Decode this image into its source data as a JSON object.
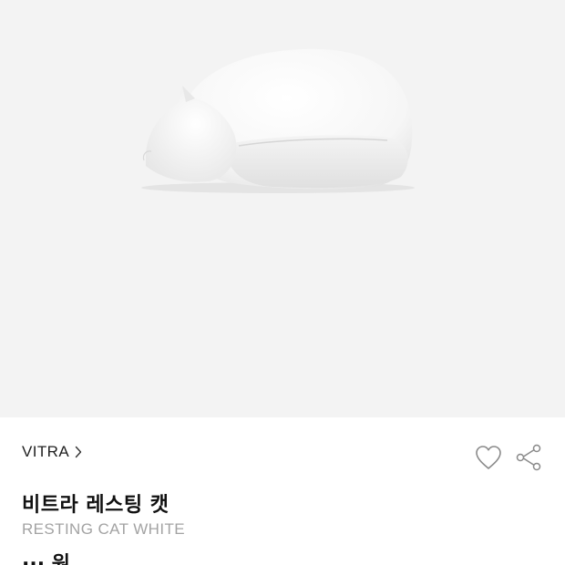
{
  "product": {
    "image_alt": "Vitra Resting Cat white figurine",
    "brand": "VITRA",
    "title_ko": "비트라 레스팅 캣",
    "title_en": "RESTING CAT WHITE",
    "price_partial": "··· 원"
  },
  "icons": {
    "brand_chevron": "chevron-right-icon",
    "wishlist": "heart-icon",
    "share": "share-icon"
  },
  "colors": {
    "hero_background": "#f3f3f3",
    "brand_text": "#1f1f1f",
    "subtitle_text": "#a3a3a3",
    "icon_stroke": "#8a8a8a"
  }
}
